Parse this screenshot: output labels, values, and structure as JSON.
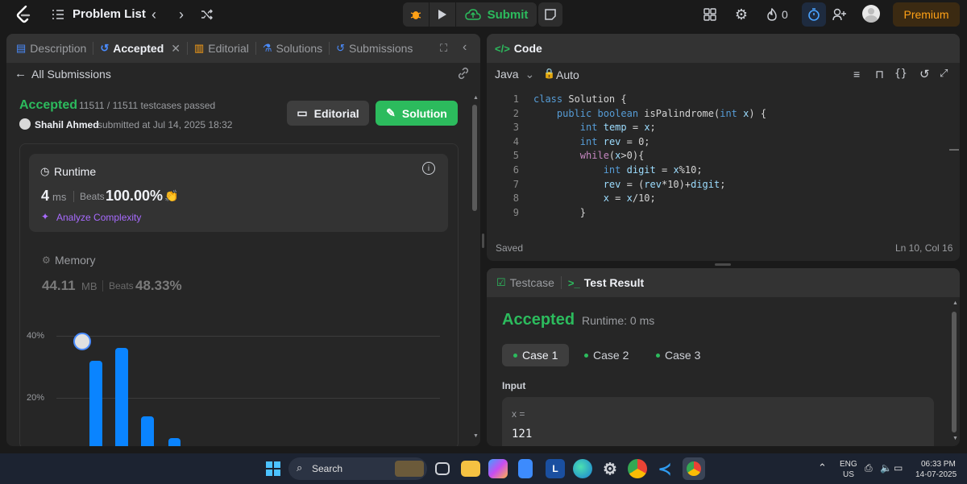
{
  "topbar": {
    "problem_list": "Problem List",
    "submit": "Submit",
    "streak": "0",
    "premium": "Premium"
  },
  "left_tabs": {
    "description": "Description",
    "accepted": "Accepted",
    "editorial": "Editorial",
    "solutions": "Solutions",
    "submissions": "Submissions"
  },
  "submission": {
    "back": "All Submissions",
    "status": "Accepted",
    "testcases": "11511 / 11511 testcases passed",
    "user": "Shahil Ahmed",
    "submitted_at": "submitted at Jul 14, 2025 18:32",
    "editorial_btn": "Editorial",
    "solution_btn": "Solution"
  },
  "runtime": {
    "label": "Runtime",
    "value": "4",
    "unit": "ms",
    "beats_label": "Beats",
    "beats": "100.00%",
    "analyze": "Analyze Complexity"
  },
  "memory": {
    "label": "Memory",
    "value": "44.11",
    "unit": "MB",
    "beats_label": "Beats",
    "beats": "48.33%"
  },
  "chart_data": {
    "type": "bar",
    "y_ticks": [
      "40%",
      "20%"
    ],
    "values": [
      32,
      36,
      14,
      7
    ],
    "ylim": [
      0,
      40
    ]
  },
  "code_panel": {
    "title": "Code",
    "language": "Java",
    "mode": "Auto",
    "saved": "Saved",
    "position": "Ln 10, Col 16",
    "lines": [
      {
        "n": "1",
        "t": "class Solution {"
      },
      {
        "n": "2",
        "t": "    public boolean isPalindrome(int x) {"
      },
      {
        "n": "3",
        "t": "        int temp = x;"
      },
      {
        "n": "4",
        "t": "        int rev = 0;"
      },
      {
        "n": "5",
        "t": "        while(x>0){"
      },
      {
        "n": "6",
        "t": "            int digit = x%10;"
      },
      {
        "n": "7",
        "t": "            rev = (rev*10)+digit;"
      },
      {
        "n": "8",
        "t": "            x = x/10;"
      },
      {
        "n": "9",
        "t": "        }"
      }
    ]
  },
  "test_panel": {
    "testcase_tab": "Testcase",
    "result_tab": "Test Result",
    "status": "Accepted",
    "runtime": "Runtime: 0 ms",
    "cases": [
      "Case 1",
      "Case 2",
      "Case 3"
    ],
    "input_label": "Input",
    "var_name": "x =",
    "var_value": "121"
  },
  "taskbar": {
    "search": "Search",
    "lang_top": "ENG",
    "lang_bottom": "US",
    "time": "06:33 PM",
    "date": "14-07-2025"
  }
}
